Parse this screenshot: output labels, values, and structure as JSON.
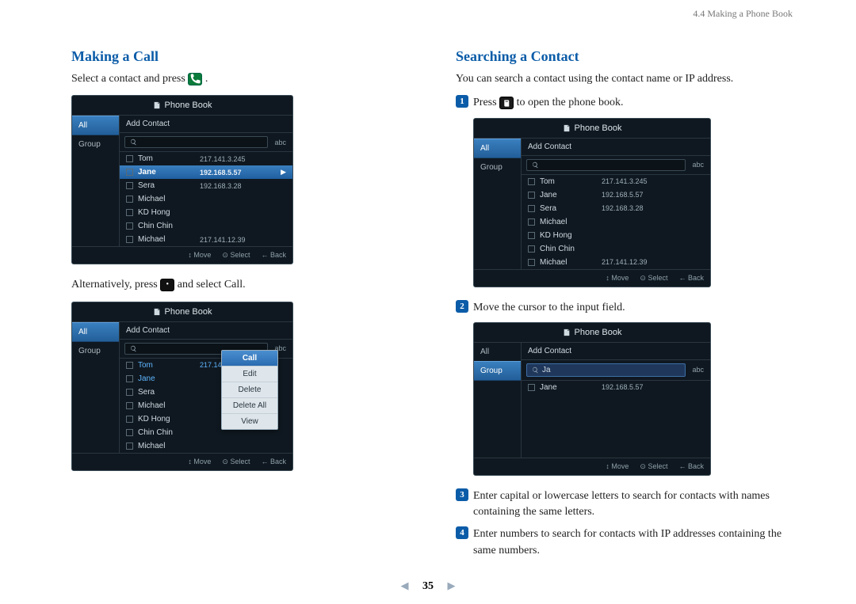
{
  "breadcrumb": "4.4 Making a Phone Book",
  "page_number": "35",
  "left": {
    "heading": "Making a Call",
    "intro_pre": "Select a contact and press ",
    "intro_post": ".",
    "alt_pre": "Alternatively, press ",
    "alt_post": " and select Call."
  },
  "right": {
    "heading": "Searching a Contact",
    "intro": "You can search a contact using the contact name or IP address.",
    "steps": {
      "s1_pre": "Press ",
      "s1_post": " to open the phone book.",
      "s2": "Move the cursor to the input field.",
      "s3": "Enter capital or lowercase letters to search for contacts with names containing the same letters.",
      "s4": "Enter numbers to search for contacts with IP addresses containing the same numbers."
    }
  },
  "device": {
    "title": "Phone Book",
    "sidebar": {
      "all": "All",
      "group": "Group"
    },
    "add_contact": "Add Contact",
    "search_mode": "abc",
    "search_value_ja": "Ja",
    "footer": {
      "move": "Move",
      "select": "Select",
      "back": "Back"
    },
    "contacts_full": [
      {
        "name": "Tom",
        "ip": "217.141.3.245"
      },
      {
        "name": "Jane",
        "ip": "192.168.5.57"
      },
      {
        "name": "Sera",
        "ip": "192.168.3.28"
      },
      {
        "name": "Michael",
        "ip": ""
      },
      {
        "name": "KD Hong",
        "ip": ""
      },
      {
        "name": "Chin Chin",
        "ip": ""
      },
      {
        "name": "Michael",
        "ip": "217.141.12.39"
      }
    ],
    "contacts_filtered": [
      {
        "name": "Jane",
        "ip": "192.168.5.57"
      }
    ],
    "context_menu": [
      "Call",
      "Edit",
      "Delete",
      "Delete All",
      "View"
    ]
  }
}
